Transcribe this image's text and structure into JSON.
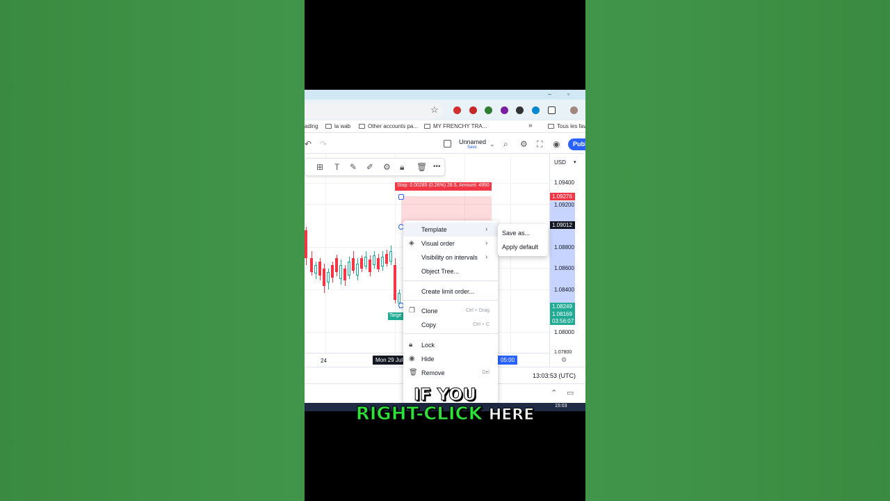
{
  "browser": {
    "bookmarks": [
      "ading",
      "la wab",
      "Other accounts pa...",
      "MY FRENCHY TRA...",
      "Tous les fav"
    ],
    "more_bookmarks": "»"
  },
  "tv_header": {
    "layout_name": "Unnamed",
    "layout_sub": "Save",
    "publish_label": "Publ"
  },
  "chart": {
    "currency": "USD",
    "stop_label": "Stop: 0.00285 (0.26%) 28.5, Amount: 4950",
    "target_label": "Targe",
    "price_levels": [
      "1.09400",
      "1.09200",
      "1.08800",
      "1.08600",
      "1.08400",
      "1.08000",
      "1.07800"
    ],
    "badges": {
      "stop_price": "1.09276",
      "current_price": "1.09012",
      "target_price": "1.08249",
      "last_price": "1.08169",
      "countdown": "03:56:07"
    },
    "time_labels": [
      "24"
    ],
    "time_badge_left": "Mon 29 Jul '24",
    "time_badge_right": "05:00",
    "clock": "13:03:53 (UTC)",
    "taskbar_time": "15:03",
    "colors": {
      "down": "#f23645",
      "up": "#22ab94",
      "accent": "#2962ff"
    }
  },
  "context_menu": {
    "items": [
      {
        "label": "Template",
        "icon": "",
        "arrow": true
      },
      {
        "label": "Visual order",
        "icon": "layers-icon",
        "arrow": true
      },
      {
        "label": "Visibility on intervals",
        "icon": "",
        "arrow": true
      },
      {
        "label": "Object Tree...",
        "icon": ""
      },
      {
        "label": "Create limit order..."
      },
      {
        "label": "Clone",
        "shortcut": "Ctrl + Drag"
      },
      {
        "label": "Copy",
        "shortcut": "Ctrl + C"
      },
      {
        "label": "Lock"
      },
      {
        "label": "Hide"
      },
      {
        "label": "Remove",
        "shortcut": "Del"
      }
    ],
    "submenu": [
      "Save as...",
      "Apply default"
    ]
  },
  "caption": {
    "line1": "IF YOU",
    "highlight": "RIGHT-CLICK",
    "rest": "HERE"
  }
}
